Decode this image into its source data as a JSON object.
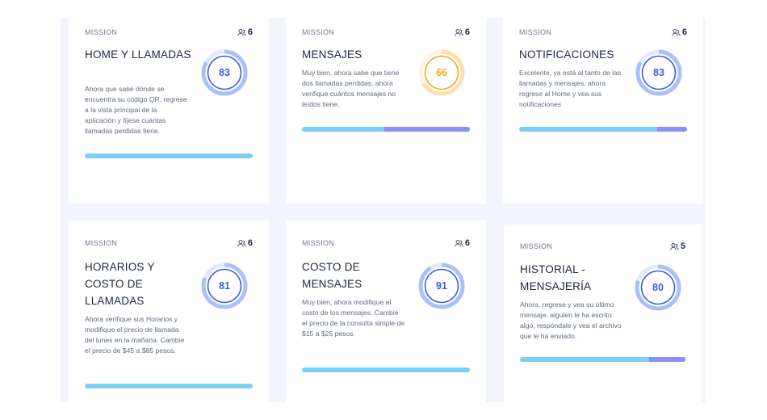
{
  "colors": {
    "blue_ring": "#3b5ee0",
    "blue_ring_light": "#a9c1fa",
    "orange_ring": "#f6a623",
    "orange_ring_light": "#fde0b0",
    "bar_primary": "#7dcef5",
    "bar_secondary": "#8a8ff2"
  },
  "cards": [
    {
      "label": "MISSION",
      "members": "6",
      "title": "HOME Y LLAMADAS",
      "description": "Ahora que sabe dónde se encuentra su código QR, regrese a la vista principal de la aplicación y fíjese cuántas llamadas perdidas tiene.",
      "score": "83",
      "score_color": "blue",
      "progress_secondary_fraction": 0.0,
      "icon": "users-icon"
    },
    {
      "label": "MISSION",
      "members": "6",
      "title": "MENSAJES",
      "description": "Muy bien, ahora sabe que tiene dos llamadas perdidas, ahora verifique cuántos mensajes no leídos tiene.",
      "score": "66",
      "score_color": "orange",
      "progress_secondary_fraction": 0.51,
      "icon": "users-icon"
    },
    {
      "label": "MISSION",
      "members": "6",
      "title": "NOTIFICACIONES",
      "description": "Excelente, ya está al tanto de las llamadas y mensajes, ahora regrese al Home y vea sus notificaciones",
      "score": "83",
      "score_color": "blue",
      "progress_secondary_fraction": 0.18,
      "icon": "users-icon"
    },
    {
      "label": "MISSION",
      "members": "6",
      "title": "HORARIOS Y COSTO DE LLAMADAS",
      "description": "Ahora verifique sus Horarios y modifique el precio de llamada del lunes en la mañana. Cambie el precio de $45 a $85 pesos.",
      "score": "81",
      "score_color": "blue",
      "progress_secondary_fraction": 0.0,
      "icon": "users-icon"
    },
    {
      "label": "MISSION",
      "members": "6",
      "title": "COSTO DE MENSAJES",
      "description": "Muy bien, ahora modifique el costo de los mensajes. Cambie el precio de la consulta simple de $15 a $25 pesos.",
      "score": "91",
      "score_color": "blue",
      "progress_secondary_fraction": 0.0,
      "icon": "users-icon"
    },
    {
      "label": "MISSION",
      "members": "5",
      "title": "HISTORIAL - MENSAJERÍA",
      "description": "Ahora, regrese y vea su último mensaje, alguien le ha escrito algo, respóndale y vea el archivo que le ha enviado.",
      "score": "80",
      "score_color": "blue",
      "progress_secondary_fraction": 0.22,
      "icon": "users-icon"
    }
  ]
}
